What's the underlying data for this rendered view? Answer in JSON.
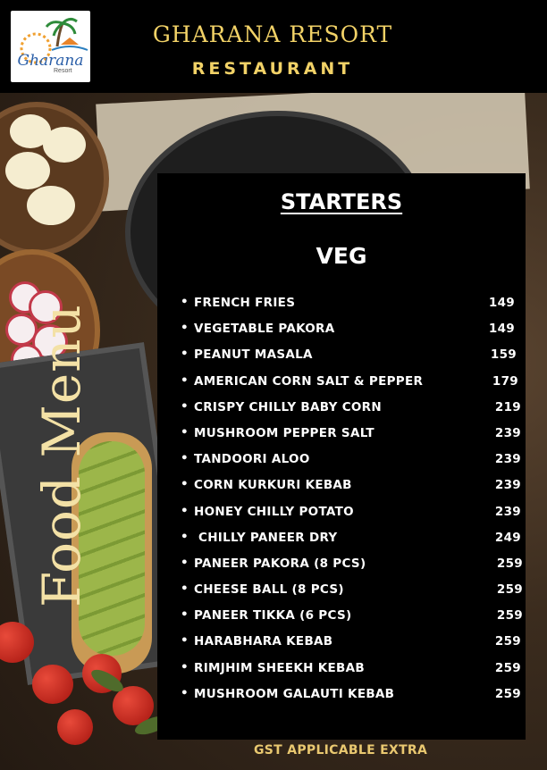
{
  "header": {
    "logo_text": "Gharana",
    "logo_sub": "Resort",
    "title": "GHARANA RESORT",
    "subtitle": "RESTAURANT"
  },
  "side_text": "Food Menu",
  "menu": {
    "section": "STARTERS",
    "category": "VEG",
    "items": [
      {
        "name": "FRENCH FRIES",
        "price": "149"
      },
      {
        "name": "VEGETABLE PAKORA",
        "price": "149"
      },
      {
        "name": "PEANUT MASALA",
        "price": "159"
      },
      {
        "name": "AMERICAN CORN SALT & PEPPER",
        "price": "179"
      },
      {
        "name": "CRISPY CHILLY BABY CORN",
        "price": "219"
      },
      {
        "name": "MUSHROOM PEPPER SALT",
        "price": "239"
      },
      {
        "name": "TANDOORI ALOO",
        "price": "239"
      },
      {
        "name": "CORN KURKURI KEBAB",
        "price": "239"
      },
      {
        "name": "HONEY CHILLY POTATO",
        "price": "239"
      },
      {
        "name": " CHILLY PANEER DRY",
        "price": "249"
      },
      {
        "name": "PANEER PAKORA (8 PCS)",
        "price": "259"
      },
      {
        "name": "CHEESE BALL (8 PCS)",
        "price": "259"
      },
      {
        "name": "PANEER TIKKA (6 PCS)",
        "price": "259"
      },
      {
        "name": "HARABHARA KEBAB",
        "price": "259"
      },
      {
        "name": "RIMJHIM SHEEKH KEBAB",
        "price": "259"
      },
      {
        "name": "MUSHROOM GALAUTI KEBAB",
        "price": "259"
      }
    ]
  },
  "footer": {
    "note": "GST APPLICABLE EXTRA"
  },
  "colors": {
    "gold": "#f2d267",
    "panel": "#000000"
  }
}
